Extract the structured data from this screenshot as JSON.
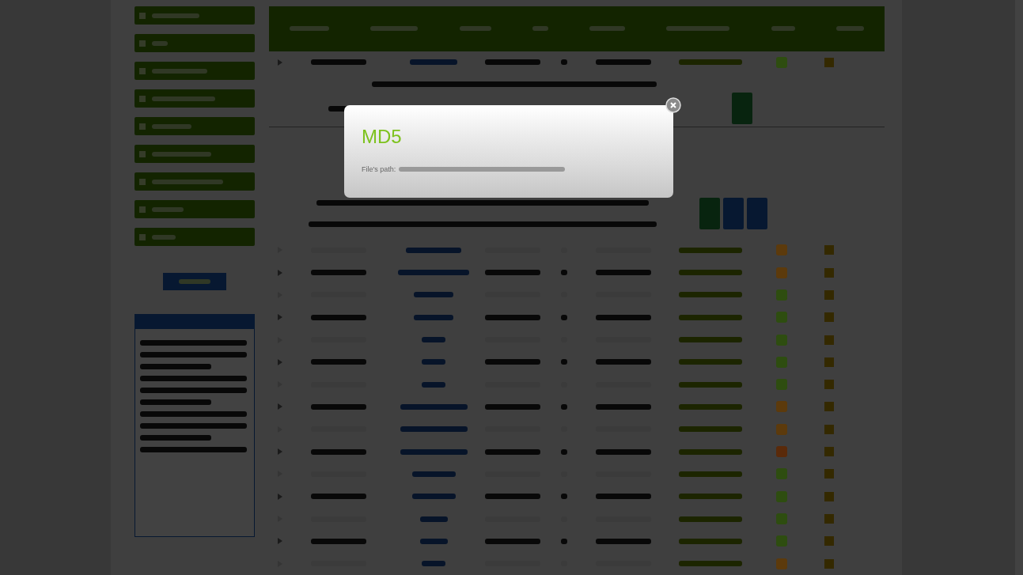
{
  "modal": {
    "title": "MD5",
    "label": "File's path:"
  },
  "top_row": {
    "disabled": false,
    "color": "#2e4d10"
  },
  "rows": [
    {
      "disabled": true,
      "color": "#5c3a0c"
    },
    {
      "disabled": false,
      "color": "#5c3a0c"
    },
    {
      "disabled": true,
      "color": "#2e4d10"
    },
    {
      "disabled": false,
      "color": "#2e4d10"
    },
    {
      "disabled": true,
      "color": "#2e4d10"
    },
    {
      "disabled": false,
      "color": "#2e4d10"
    },
    {
      "disabled": true,
      "color": "#2e4d10"
    },
    {
      "disabled": false,
      "color": "#5c3a0c"
    },
    {
      "disabled": true,
      "color": "#5c3a0c"
    },
    {
      "disabled": false,
      "color": "#5a2a0a"
    },
    {
      "disabled": true,
      "color": "#2e4d10"
    },
    {
      "disabled": false,
      "color": "#2e4d10"
    },
    {
      "disabled": true,
      "color": "#2e4d10"
    },
    {
      "disabled": false,
      "color": "#2e4d10"
    },
    {
      "disabled": true,
      "color": "#5c3a0c"
    }
  ]
}
